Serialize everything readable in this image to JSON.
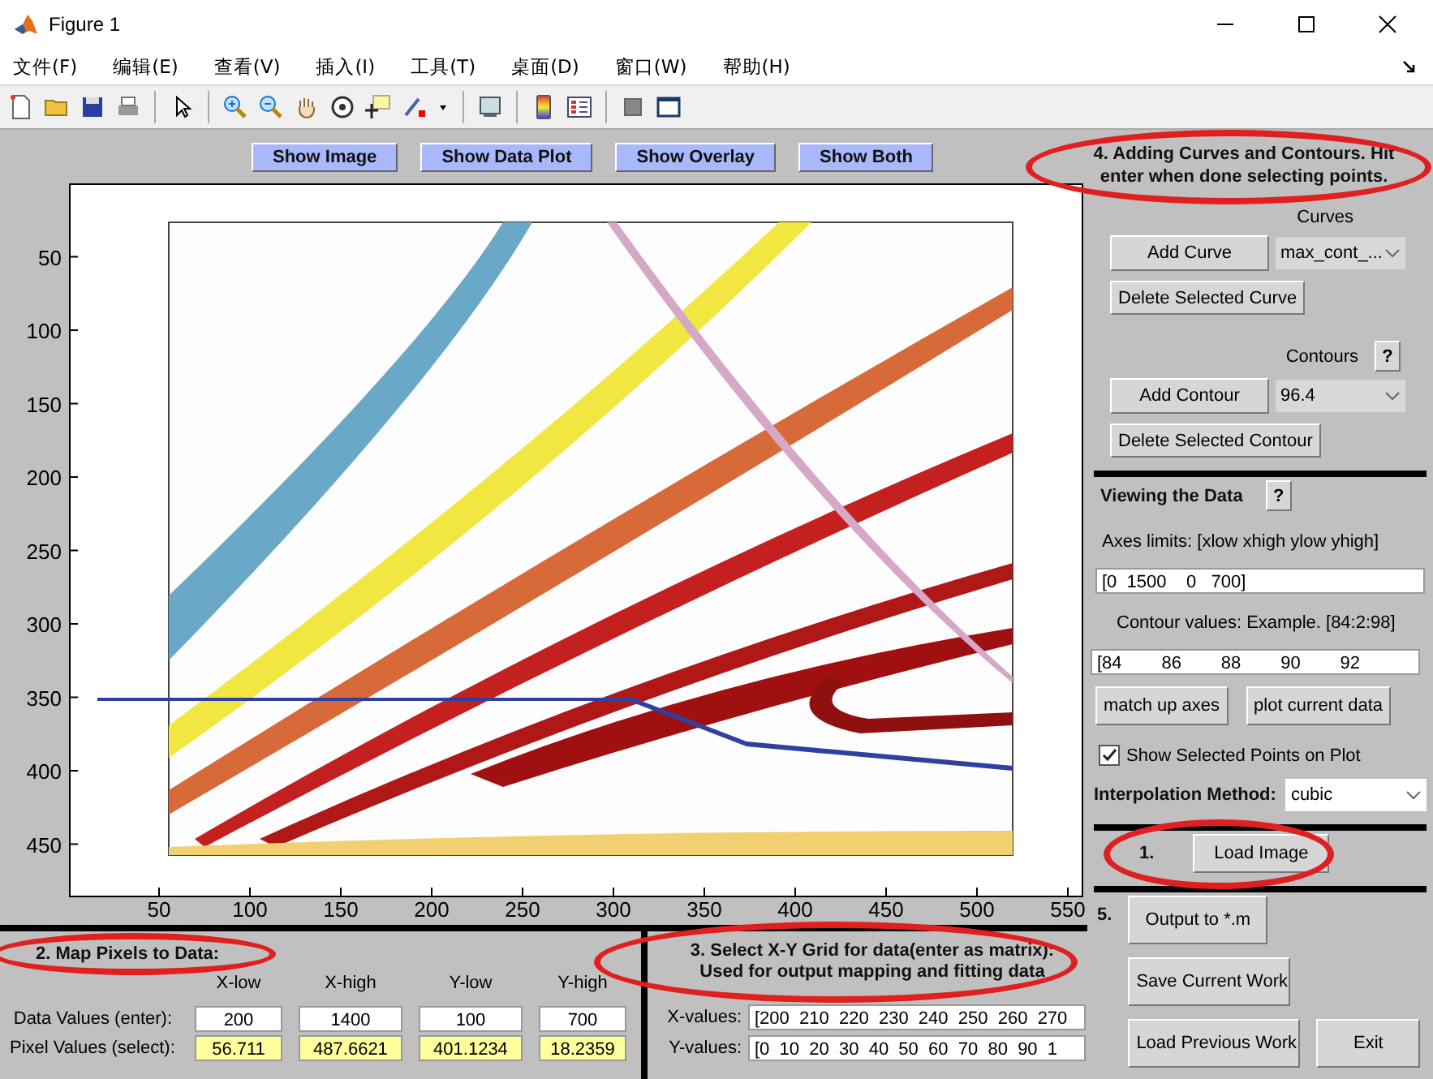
{
  "window": {
    "title": "Figure 1"
  },
  "menu": [
    "文件(F)",
    "编辑(E)",
    "查看(V)",
    "插入(I)",
    "工具(T)",
    "桌面(D)",
    "窗口(W)",
    "帮助(H)"
  ],
  "view_buttons": [
    "Show Image",
    "Show Data Plot",
    "Show Overlay",
    "Show Both"
  ],
  "axes": {
    "xticks": [
      "50",
      "100",
      "150",
      "200",
      "250",
      "300",
      "350",
      "400",
      "450",
      "500",
      "550"
    ],
    "yticks": [
      "50",
      "100",
      "150",
      "200",
      "250",
      "300",
      "350",
      "400",
      "450"
    ]
  },
  "curves_panel": {
    "heading_lines": [
      "4. Adding Curves and Contours.  Hit",
      "enter when done selecting points."
    ],
    "circled": true,
    "curves_label": "Curves",
    "add_curve": "Add Curve",
    "curve_select": "max_cont_...",
    "delete_curve": "Delete Selected Curve",
    "contours_label": "Contours",
    "help": "?",
    "add_contour": "Add Contour",
    "contour_select": "96.4",
    "delete_contour": "Delete Selected Contour"
  },
  "viewing": {
    "heading": "Viewing the Data",
    "help": "?",
    "axes_label": "Axes limits: [xlow xhigh ylow yhigh]",
    "axes_value": "[0  1500    0   700]",
    "contour_label": "Contour values: Example.  [84:2:98]",
    "contour_value": "[84        86        88        90        92",
    "match_button": "match up axes",
    "plot_button": "plot current data",
    "show_points": {
      "label": "Show Selected Points on Plot",
      "checked": true
    },
    "interp_label": "Interpolation Method:",
    "interp_value": "cubic"
  },
  "load": {
    "step": "1.",
    "button": "Load Image",
    "circled": true
  },
  "map": {
    "heading": "2. Map Pixels to Data:",
    "circled": true,
    "columns": [
      "X-low",
      "X-high",
      "Y-low",
      "Y-high"
    ],
    "rows": [
      {
        "label": "Data Values (enter):",
        "kind": "entry",
        "values": [
          "200",
          "1400",
          "100",
          "700"
        ]
      },
      {
        "label": "Pixel Values (select):",
        "kind": "selected",
        "values": [
          "56.711",
          "487.6621",
          "401.1234",
          "18.2359"
        ]
      }
    ]
  },
  "grid": {
    "heading_lines": [
      "3. Select X-Y Grid for data(enter as matrix):",
      "Used for output mapping and fitting data"
    ],
    "circled": true,
    "fields": [
      {
        "label": "X-values:",
        "value": "[200  210  220  230  240  250  260  270"
      },
      {
        "label": "Y-values:",
        "value": "[0  10  20  30  40  50  60  70  80  90  1"
      }
    ]
  },
  "output": {
    "step": "5.",
    "buttons": [
      "Output to *.m",
      "Save Current Work",
      "Load Previous Work",
      "Exit"
    ]
  }
}
